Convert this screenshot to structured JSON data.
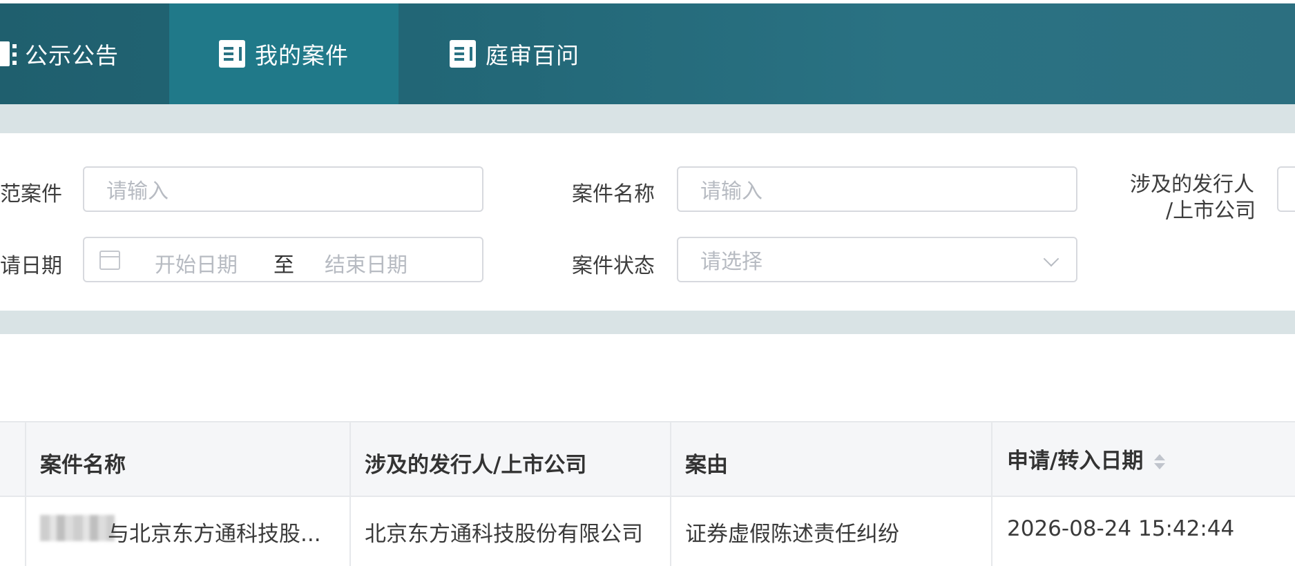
{
  "nav": {
    "tabs": [
      {
        "label": "公示公告",
        "icon": "announcement-icon",
        "active": false
      },
      {
        "label": "我的案件",
        "icon": "document-icon",
        "active": true
      },
      {
        "label": "庭审百问",
        "icon": "document-icon",
        "active": false
      }
    ]
  },
  "filters": {
    "row1": {
      "demo_case_label": "范案件",
      "demo_case_placeholder": "请输入",
      "case_name_label": "案件名称",
      "case_name_placeholder": "请输入",
      "issuer_label_line1": "涉及的发行人",
      "issuer_label_line2": "/上市公司"
    },
    "row2": {
      "apply_date_label": "请日期",
      "start_placeholder": "开始日期",
      "range_sep": "至",
      "end_placeholder": "结束日期",
      "status_label": "案件状态",
      "status_placeholder": "请选择"
    }
  },
  "table": {
    "headers": [
      "案件名称",
      "涉及的发行人/上市公司",
      "案由",
      "申请/转入日期"
    ],
    "rows": [
      {
        "case_name": "与北京东方通科技股...",
        "issuer": "北京东方通科技股份有限公司",
        "cause": "证券虚假陈述责任纠纷",
        "date": "2026-08-24 15:42:44"
      }
    ]
  },
  "colors": {
    "nav_bg": "#236878",
    "nav_active": "#207989",
    "band": "#d9e3e5",
    "table_header_bg": "#f5f6f8"
  }
}
